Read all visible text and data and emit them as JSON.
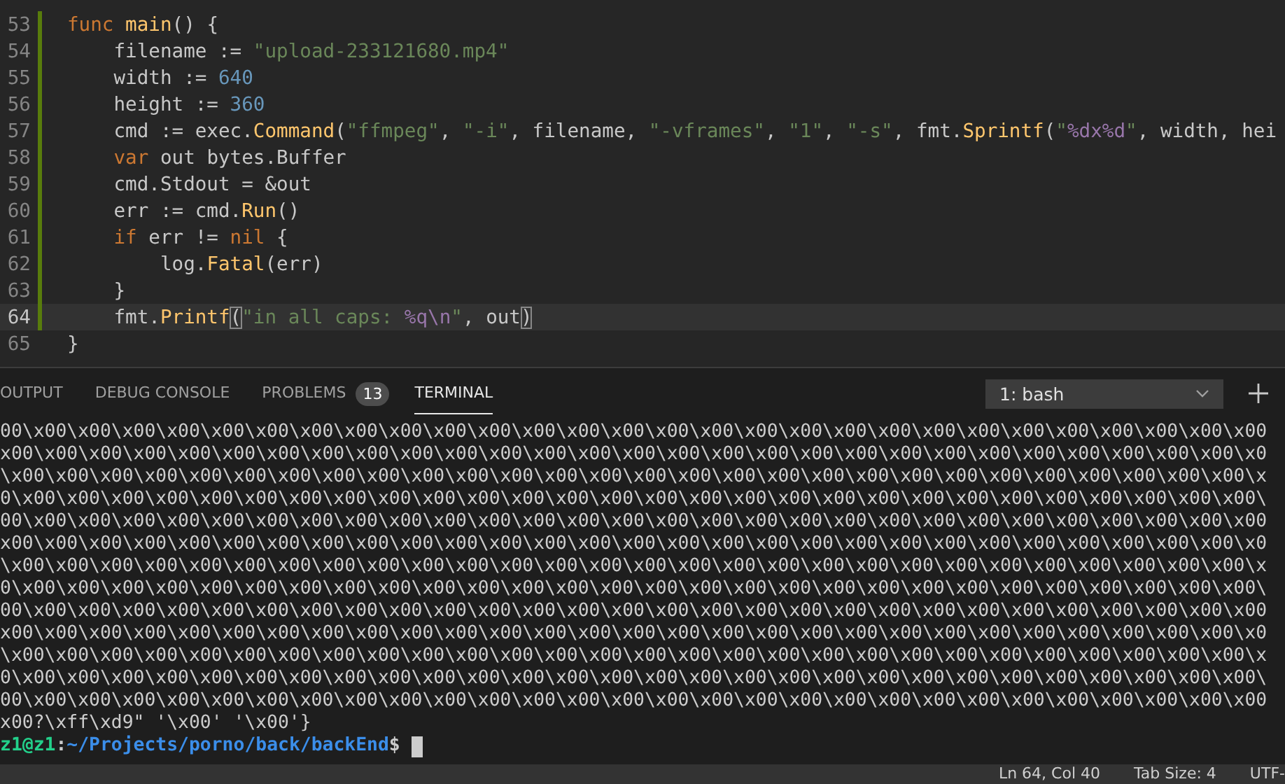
{
  "editor": {
    "lines": [
      {
        "number": "53",
        "changed": true,
        "current": false,
        "tokens": [
          {
            "kind": "keyword",
            "text": "func "
          },
          {
            "kind": "function",
            "text": "main"
          },
          {
            "kind": "plain",
            "text": "() {"
          }
        ]
      },
      {
        "number": "54",
        "changed": true,
        "current": false,
        "tokens": [
          {
            "kind": "plain",
            "text": "    filename := "
          },
          {
            "kind": "string",
            "text": "\"upload-233121680.mp4\""
          }
        ]
      },
      {
        "number": "55",
        "changed": true,
        "current": false,
        "tokens": [
          {
            "kind": "plain",
            "text": "    width := "
          },
          {
            "kind": "number",
            "text": "640"
          }
        ]
      },
      {
        "number": "56",
        "changed": true,
        "current": false,
        "tokens": [
          {
            "kind": "plain",
            "text": "    height := "
          },
          {
            "kind": "number",
            "text": "360"
          }
        ]
      },
      {
        "number": "57",
        "changed": true,
        "current": false,
        "tokens": [
          {
            "kind": "plain",
            "text": "    cmd := exec."
          },
          {
            "kind": "function",
            "text": "Command"
          },
          {
            "kind": "plain",
            "text": "("
          },
          {
            "kind": "string",
            "text": "\"ffmpeg\""
          },
          {
            "kind": "plain",
            "text": ", "
          },
          {
            "kind": "string",
            "text": "\"-i\""
          },
          {
            "kind": "plain",
            "text": ", filename, "
          },
          {
            "kind": "string",
            "text": "\"-vframes\""
          },
          {
            "kind": "plain",
            "text": ", "
          },
          {
            "kind": "string",
            "text": "\"1\""
          },
          {
            "kind": "plain",
            "text": ", "
          },
          {
            "kind": "string",
            "text": "\"-s\""
          },
          {
            "kind": "plain",
            "text": ", fmt."
          },
          {
            "kind": "function",
            "text": "Sprintf"
          },
          {
            "kind": "plain",
            "text": "("
          },
          {
            "kind": "string",
            "text": "\""
          },
          {
            "kind": "format",
            "text": "%dx%d"
          },
          {
            "kind": "string",
            "text": "\""
          },
          {
            "kind": "plain",
            "text": ", width, hei"
          }
        ]
      },
      {
        "number": "58",
        "changed": true,
        "current": false,
        "tokens": [
          {
            "kind": "keyword",
            "text": "    var"
          },
          {
            "kind": "plain",
            "text": " out bytes.Buffer"
          }
        ]
      },
      {
        "number": "59",
        "changed": true,
        "current": false,
        "tokens": [
          {
            "kind": "plain",
            "text": "    cmd.Stdout = &out"
          }
        ]
      },
      {
        "number": "60",
        "changed": true,
        "current": false,
        "tokens": [
          {
            "kind": "plain",
            "text": "    err := cmd."
          },
          {
            "kind": "function",
            "text": "Run"
          },
          {
            "kind": "plain",
            "text": "()"
          }
        ]
      },
      {
        "number": "61",
        "changed": true,
        "current": false,
        "tokens": [
          {
            "kind": "keyword",
            "text": "    if"
          },
          {
            "kind": "plain",
            "text": " err != "
          },
          {
            "kind": "keyword",
            "text": "nil"
          },
          {
            "kind": "plain",
            "text": " {"
          }
        ]
      },
      {
        "number": "62",
        "changed": true,
        "current": false,
        "tokens": [
          {
            "kind": "plain",
            "text": "        log."
          },
          {
            "kind": "function",
            "text": "Fatal"
          },
          {
            "kind": "plain",
            "text": "(err)"
          }
        ]
      },
      {
        "number": "63",
        "changed": true,
        "current": false,
        "tokens": [
          {
            "kind": "plain",
            "text": "    }"
          }
        ]
      },
      {
        "number": "64",
        "changed": true,
        "current": true,
        "tokens": [
          {
            "kind": "plain",
            "text": "    fmt."
          },
          {
            "kind": "function",
            "text": "Printf"
          },
          {
            "kind": "match",
            "text": "("
          },
          {
            "kind": "string",
            "text": "\"in all caps: "
          },
          {
            "kind": "format",
            "text": "%q\\n"
          },
          {
            "kind": "string",
            "text": "\""
          },
          {
            "kind": "plain",
            "text": ", out"
          },
          {
            "kind": "match",
            "text": ")"
          }
        ]
      },
      {
        "number": "65",
        "changed": false,
        "current": false,
        "tokens": [
          {
            "kind": "plain",
            "text": "}"
          }
        ]
      }
    ]
  },
  "panel": {
    "tabs": [
      {
        "label": "OUTPUT",
        "selected": false
      },
      {
        "label": "DEBUG CONSOLE",
        "selected": false
      },
      {
        "label": "PROBLEMS",
        "selected": false,
        "badge": "13"
      },
      {
        "label": "TERMINAL",
        "selected": true
      }
    ],
    "terminal_select": "1: bash",
    "terminal": {
      "output": [
        "00\\x00\\x00\\x00\\x00\\x00\\x00\\x00\\x00\\x00\\x00\\x00\\x00\\x00\\x00\\x00\\x00\\x00\\x00\\x00\\x00\\x00\\x00\\x00\\x00\\x00\\x00\\x00\\x00",
        "x00\\x00\\x00\\x00\\x00\\x00\\x00\\x00\\x00\\x00\\x00\\x00\\x00\\x00\\x00\\x00\\x00\\x00\\x00\\x00\\x00\\x00\\x00\\x00\\x00\\x00\\x00\\x00\\x0",
        "\\x00\\x00\\x00\\x00\\x00\\x00\\x00\\x00\\x00\\x00\\x00\\x00\\x00\\x00\\x00\\x00\\x00\\x00\\x00\\x00\\x00\\x00\\x00\\x00\\x00\\x00\\x00\\x00\\x",
        "0\\x00\\x00\\x00\\x00\\x00\\x00\\x00\\x00\\x00\\x00\\x00\\x00\\x00\\x00\\x00\\x00\\x00\\x00\\x00\\x00\\x00\\x00\\x00\\x00\\x00\\x00\\x00\\x00\\",
        "00\\x00\\x00\\x00\\x00\\x00\\x00\\x00\\x00\\x00\\x00\\x00\\x00\\x00\\x00\\x00\\x00\\x00\\x00\\x00\\x00\\x00\\x00\\x00\\x00\\x00\\x00\\x00\\x00",
        "x00\\x00\\x00\\x00\\x00\\x00\\x00\\x00\\x00\\x00\\x00\\x00\\x00\\x00\\x00\\x00\\x00\\x00\\x00\\x00\\x00\\x00\\x00\\x00\\x00\\x00\\x00\\x00\\x0",
        "\\x00\\x00\\x00\\x00\\x00\\x00\\x00\\x00\\x00\\x00\\x00\\x00\\x00\\x00\\x00\\x00\\x00\\x00\\x00\\x00\\x00\\x00\\x00\\x00\\x00\\x00\\x00\\x00\\x",
        "0\\x00\\x00\\x00\\x00\\x00\\x00\\x00\\x00\\x00\\x00\\x00\\x00\\x00\\x00\\x00\\x00\\x00\\x00\\x00\\x00\\x00\\x00\\x00\\x00\\x00\\x00\\x00\\x00\\",
        "00\\x00\\x00\\x00\\x00\\x00\\x00\\x00\\x00\\x00\\x00\\x00\\x00\\x00\\x00\\x00\\x00\\x00\\x00\\x00\\x00\\x00\\x00\\x00\\x00\\x00\\x00\\x00\\x00",
        "x00\\x00\\x00\\x00\\x00\\x00\\x00\\x00\\x00\\x00\\x00\\x00\\x00\\x00\\x00\\x00\\x00\\x00\\x00\\x00\\x00\\x00\\x00\\x00\\x00\\x00\\x00\\x00\\x0",
        "\\x00\\x00\\x00\\x00\\x00\\x00\\x00\\x00\\x00\\x00\\x00\\x00\\x00\\x00\\x00\\x00\\x00\\x00\\x00\\x00\\x00\\x00\\x00\\x00\\x00\\x00\\x00\\x00\\x",
        "0\\x00\\x00\\x00\\x00\\x00\\x00\\x00\\x00\\x00\\x00\\x00\\x00\\x00\\x00\\x00\\x00\\x00\\x00\\x00\\x00\\x00\\x00\\x00\\x00\\x00\\x00\\x00\\x00\\",
        "00\\x00\\x00\\x00\\x00\\x00\\x00\\x00\\x00\\x00\\x00\\x00\\x00\\x00\\x00\\x00\\x00\\x00\\x00\\x00\\x00\\x00\\x00\\x00\\x00\\x00\\x00\\x00\\x00",
        "x00?\\xff\\xd9\" '\\x00' '\\x00'}"
      ],
      "prompt": {
        "user": "z1@z1",
        "separator": ":",
        "path": "~/Projects/porno/back/backEnd",
        "symbol": "$"
      }
    }
  },
  "status_bar": [
    "Ln 64, Col 40",
    "Tab Size: 4",
    "UTF-"
  ]
}
